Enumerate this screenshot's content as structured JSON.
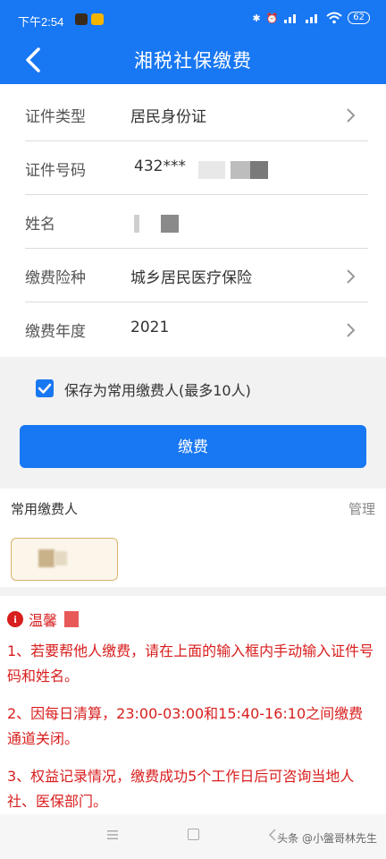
{
  "status_bar": {
    "time": "下午2:54",
    "battery": "62"
  },
  "header": {
    "title": "湘税社保缴费"
  },
  "form": {
    "id_type_label": "证件类型",
    "id_type_value": "居民身份证",
    "id_number_label": "证件号码",
    "id_number_value": "432***",
    "name_label": "姓名",
    "insurance_label": "缴费险种",
    "insurance_value": "城乡居民医疗保险",
    "year_label": "缴费年度",
    "year_value": "2021"
  },
  "save_payer": {
    "label": "保存为常用缴费人(最多10人)",
    "checked": true
  },
  "pay_button": "缴费",
  "common_payers": {
    "title": "常用缴费人",
    "manage": "管理"
  },
  "tips": {
    "title": "温馨",
    "items": [
      "1、若要帮他人缴费，请在上面的输入框内手动输入证件号码和姓名。",
      "2、因每日清算，23:00-03:00和15:40-16:10之间缴费通道关闭。",
      "3、权益记录情况，缴费成功5个工作日后可咨询当地人社、医保部门。"
    ]
  },
  "watermark": "头条 @小盤哥林先生",
  "colors": {
    "primary": "#1877f2",
    "tip_red": "#d81e1e",
    "chip_border": "#d9b36b"
  }
}
